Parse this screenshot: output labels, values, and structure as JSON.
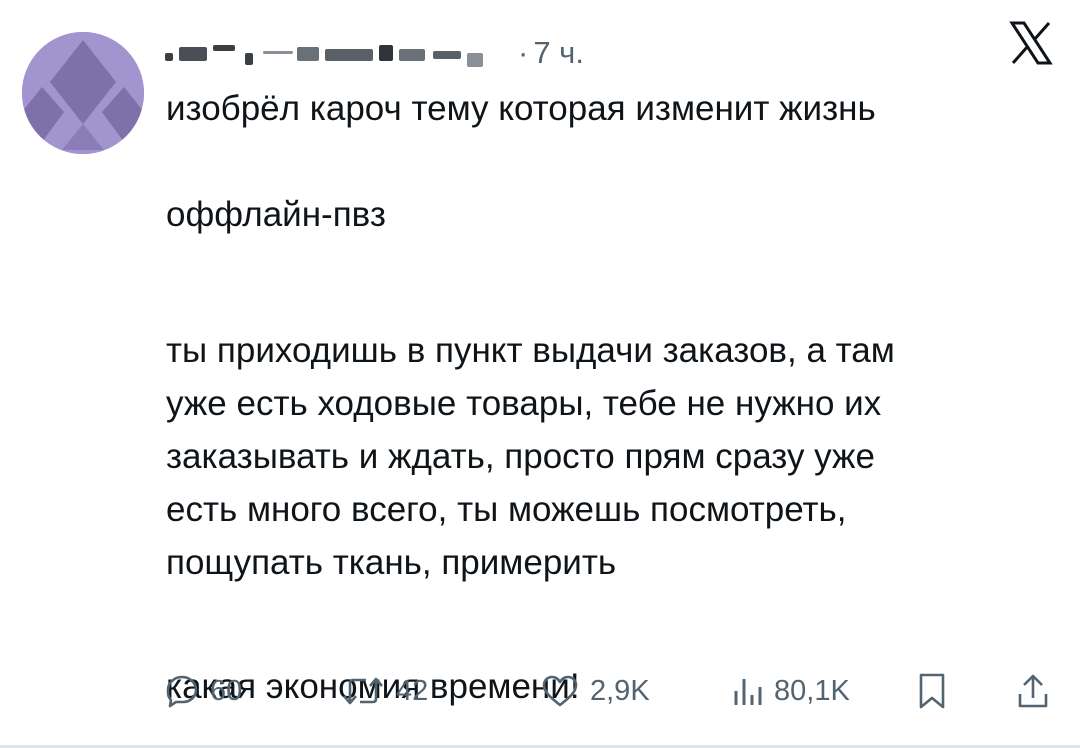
{
  "tweet": {
    "time_sep": "·",
    "time": "7 ч.",
    "paragraphs": [
      "изобрёл кароч тему которая изменит жизнь",
      "оффлайн-пвз",
      "ты приходишь в пункт выдачи заказов, а там\nуже есть ходовые товары, тебе не нужно их\nзаказывать и ждать, просто прям сразу уже\nесть много всего, ты можешь посмотреть,\nпощупать ткань, примерить",
      "какая экономия времени!"
    ]
  },
  "actions": {
    "replies": "60",
    "retweets": "42",
    "likes": "2,9K",
    "views": "80,1K"
  },
  "icons": {
    "logo": "x-logo-icon",
    "reply": "reply-icon",
    "retweet": "retweet-icon",
    "like": "heart-icon",
    "views": "views-icon",
    "bookmark": "bookmark-icon",
    "share": "share-icon"
  },
  "colors": {
    "text": "#0f1419",
    "muted": "#536471",
    "avatar": "#9b8ec4"
  }
}
